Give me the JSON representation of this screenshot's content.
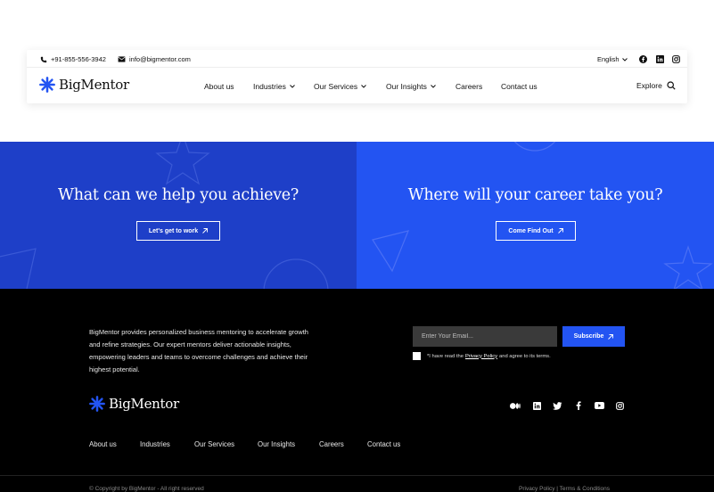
{
  "brand": {
    "name": "BigMentor",
    "accent": "#2354f2"
  },
  "topbar": {
    "phone": "+91-855-556-3942",
    "email": "info@bigmentor.com",
    "language": "English"
  },
  "nav": {
    "items": [
      {
        "label": "About us"
      },
      {
        "label": "Industries"
      },
      {
        "label": "Our Services"
      },
      {
        "label": "Our Insights"
      },
      {
        "label": "Careers"
      },
      {
        "label": "Contact us"
      }
    ],
    "explore": "Explore"
  },
  "hero": {
    "left": {
      "title": "What can we help you achieve?",
      "button": "Let's get to work"
    },
    "right": {
      "title": "Where will your career take you?",
      "button": "Come Find Out"
    }
  },
  "footer": {
    "about": "BigMentor provides personalized business mentoring to accelerate growth and refine strategies. Our expert mentors deliver actionable insights, empowering leaders and teams to overcome challenges and achieve their highest potential.",
    "newsletter": {
      "placeholder": "Enter Your Email...",
      "button": "Subscribe",
      "consent_prefix": "*I have read the",
      "consent_link": "Privacy Policy",
      "consent_suffix": "and agree to its terms."
    },
    "social": [
      "medium-icon",
      "linkedin-icon",
      "twitter-icon",
      "facebook-icon",
      "youtube-icon",
      "instagram-icon"
    ],
    "links": [
      {
        "label": "About us"
      },
      {
        "label": "Industries"
      },
      {
        "label": "Our Services"
      },
      {
        "label": "Our Insights"
      },
      {
        "label": "Careers"
      },
      {
        "label": "Contact us"
      }
    ],
    "copyright": "© Copyright by BigMentor - All right reserved",
    "legal": "Privacy Policy  |  Terms & Conditions"
  }
}
